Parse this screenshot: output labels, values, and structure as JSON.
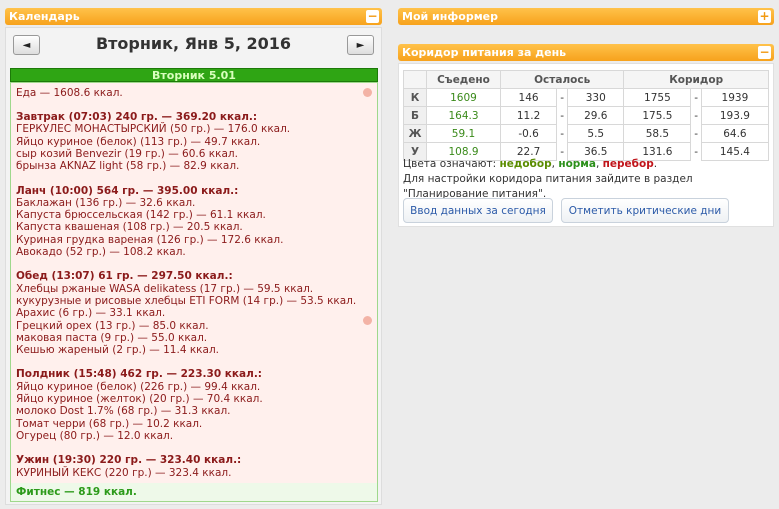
{
  "calendar": {
    "title": "Календарь",
    "collapse": "−",
    "prev": "◄",
    "next": "►",
    "date": "Вторник, Янв 5, 2016",
    "day_bar": "Вторник 5.01",
    "total": "Еда — 1608.6 ккал.",
    "lines": [
      {
        "t": "Завтрак (07:03) 240 гр. — 369.20 ккал.:",
        "meal": true
      },
      {
        "t": "ГЕРКУЛЕС МОНАСТЫРСКИЙ (50 гр.) — 176.0 ккал."
      },
      {
        "t": "Яйцо куриное (белок) (113 гр.) — 49.7 ккал."
      },
      {
        "t": "сыр козий Benvezir (19 гр.) — 60.6 ккал."
      },
      {
        "t": "брынза AKNAZ light (58 гр.) — 82.9 ккал."
      },
      {
        "t": "Ланч (10:00) 564 гр. — 395.00 ккал.:",
        "meal": true
      },
      {
        "t": "Баклажан (136 гр.) — 32.6 ккал."
      },
      {
        "t": "Капуста брюссельская (142 гр.) — 61.1 ккал."
      },
      {
        "t": "Капуста квашеная (108 гр.) — 20.5 ккал."
      },
      {
        "t": "Куриная грудка вареная (126 гр.) — 172.6 ккал."
      },
      {
        "t": "Авокадо (52 гр.) — 108.2 ккал."
      },
      {
        "t": "Обед (13:07) 61 гр. — 297.50 ккал.:",
        "meal": true
      },
      {
        "t": "Хлебцы ржаные WASA delikatess (17 гр.) — 59.5 ккал."
      },
      {
        "t": "кукурузные и рисовые хлебцы ETI FORM (14 гр.) — 53.5 ккал."
      },
      {
        "t": "Арахис (6 гр.) — 33.1 ккал."
      },
      {
        "t": "Грецкий орех (13 гр.) — 85.0 ккал."
      },
      {
        "t": "маковая паста (9 гр.) — 55.0 ккал."
      },
      {
        "t": "Кешью жареный (2 гр.) — 11.4 ккал."
      },
      {
        "t": "Полдник (15:48) 462 гр. — 223.30 ккал.:",
        "meal": true
      },
      {
        "t": "Яйцо куриное (белок) (226 гр.) — 99.4 ккал."
      },
      {
        "t": "Яйцо куриное (желток) (20 гр.) — 70.4 ккал."
      },
      {
        "t": "молоко Dost 1.7% (68 гр.) — 31.3 ккал."
      },
      {
        "t": "Томат черри (68 гр.) — 10.2 ккал."
      },
      {
        "t": "Огурец (80 гр.) — 12.0 ккал."
      },
      {
        "t": "Ужин (19:30) 220 гр. — 323.40 ккал.:",
        "meal": true
      },
      {
        "t": "КУРИНЫЙ КЕКС (220 гр.) — 323.4 ккал."
      }
    ],
    "fitness": "Фитнес — 819 ккал."
  },
  "informer": {
    "title": "Мой информер",
    "expand": "+"
  },
  "corridor": {
    "title": "Коридор питания за день",
    "collapse": "−",
    "headers": [
      "",
      "Съедено",
      "Осталось",
      "Коридор"
    ],
    "rows": [
      {
        "l": "К",
        "ate": "1609",
        "r1": "146",
        "r2": "330",
        "c1": "1755",
        "c2": "1939"
      },
      {
        "l": "Б",
        "ate": "164.3",
        "r1": "11.2",
        "r2": "29.6",
        "c1": "175.5",
        "c2": "193.9"
      },
      {
        "l": "Ж",
        "ate": "59.1",
        "r1": "-0.6",
        "r2": "5.5",
        "c1": "58.5",
        "c2": "64.6"
      },
      {
        "l": "У",
        "ate": "108.9",
        "r1": "22.7",
        "r2": "36.5",
        "c1": "131.6",
        "c2": "145.4"
      }
    ],
    "dash": "-",
    "legend_prefix": "Цвета означают:",
    "legend_under": "недобор",
    "legend_norm": "норма",
    "legend_over": "перебор",
    "hint": "Для настройки коридора питания зайдите в раздел \"Планирование питания\".",
    "btn_today": "Ввод данных за сегодня",
    "btn_critical": "Отметить критические дни"
  }
}
